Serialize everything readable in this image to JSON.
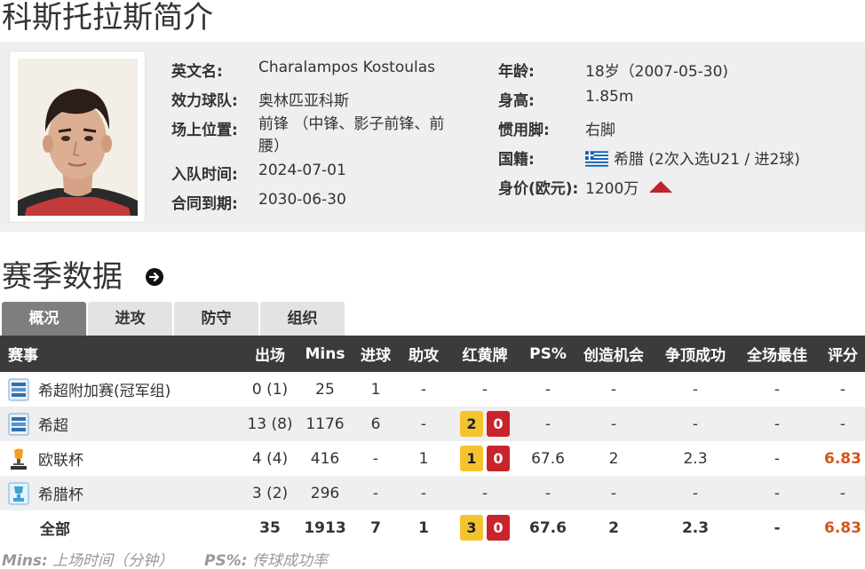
{
  "page_title": "科斯托拉斯简介",
  "profile": {
    "english_name_label": "英文名:",
    "english_name": "Charalampos Kostoulas",
    "club_label": "效力球队:",
    "club": "奥林匹亚科斯",
    "position_label": "场上位置:",
    "position": "前锋 （中锋、影子前锋、前腰）",
    "joined_label": "入队时间:",
    "joined": "2024-07-01",
    "contract_label": "合同到期:",
    "contract": "2030-06-30",
    "age_label": "年龄:",
    "age": "18岁（2007-05-30)",
    "height_label": "身高:",
    "height": "1.85m",
    "foot_label": "惯用脚:",
    "foot": "右脚",
    "nationality_label": "国籍:",
    "nationality": "希腊 (2次入选U21 / 进2球)",
    "value_label": "身价(欧元):",
    "value": "1200万",
    "value_trend": "up",
    "flag_colors": {
      "blue": "#0d5eaf",
      "white": "#ffffff"
    },
    "trend_color": "#c0232b"
  },
  "season": {
    "title": "赛季数据",
    "goto_icon": "arrow-circle-right-icon",
    "tabs": [
      {
        "label": "概况",
        "active": true
      },
      {
        "label": "进攻",
        "active": false
      },
      {
        "label": "防守",
        "active": false
      },
      {
        "label": "组织",
        "active": false
      }
    ],
    "columns": [
      "赛事",
      "出场",
      "Mins",
      "进球",
      "助攻",
      "红黄牌",
      "PS%",
      "创造机会",
      "争顶成功",
      "全场最佳",
      "评分"
    ],
    "rows": [
      {
        "competition": "希超附加赛(冠军组)",
        "icon": "super-league-icon",
        "apps": "0 (1)",
        "mins": "25",
        "goals": "1",
        "assists": "-",
        "cards_text": "-",
        "yellow": null,
        "red": null,
        "ps": "-",
        "chances": "-",
        "aerials": "-",
        "motm": "-",
        "rating": "-"
      },
      {
        "competition": "希超",
        "icon": "super-league-icon",
        "apps": "13 (8)",
        "mins": "1176",
        "goals": "6",
        "assists": "-",
        "cards_text": "",
        "yellow": "2",
        "red": "0",
        "ps": "-",
        "chances": "-",
        "aerials": "-",
        "motm": "-",
        "rating": "-"
      },
      {
        "competition": "欧联杯",
        "icon": "europa-league-icon",
        "apps": "4 (4)",
        "mins": "416",
        "goals": "-",
        "assists": "1",
        "cards_text": "",
        "yellow": "1",
        "red": "0",
        "ps": "67.6",
        "chances": "2",
        "aerials": "2.3",
        "motm": "-",
        "rating": "6.83"
      },
      {
        "competition": "希腊杯",
        "icon": "greek-cup-icon",
        "apps": "3 (2)",
        "mins": "296",
        "goals": "-",
        "assists": "-",
        "cards_text": "-",
        "yellow": null,
        "red": null,
        "ps": "-",
        "chances": "-",
        "aerials": "-",
        "motm": "-",
        "rating": "-"
      }
    ],
    "total": {
      "competition": "全部",
      "apps": "35",
      "mins": "1913",
      "goals": "7",
      "assists": "1",
      "yellow": "3",
      "red": "0",
      "ps": "67.6",
      "chances": "2",
      "aerials": "2.3",
      "motm": "-",
      "rating": "6.83"
    },
    "colors": {
      "header_bg": "#3b3b3b",
      "alt_row_bg": "#efefef",
      "yellow_card": "#f4c430",
      "red_card": "#c9232b",
      "rating": "#d2571a"
    }
  },
  "footnotes": {
    "mins_key": "Mins:",
    "mins_desc": "上场时间（分钟）",
    "ps_key": "PS%:",
    "ps_desc": "传球成功率"
  }
}
